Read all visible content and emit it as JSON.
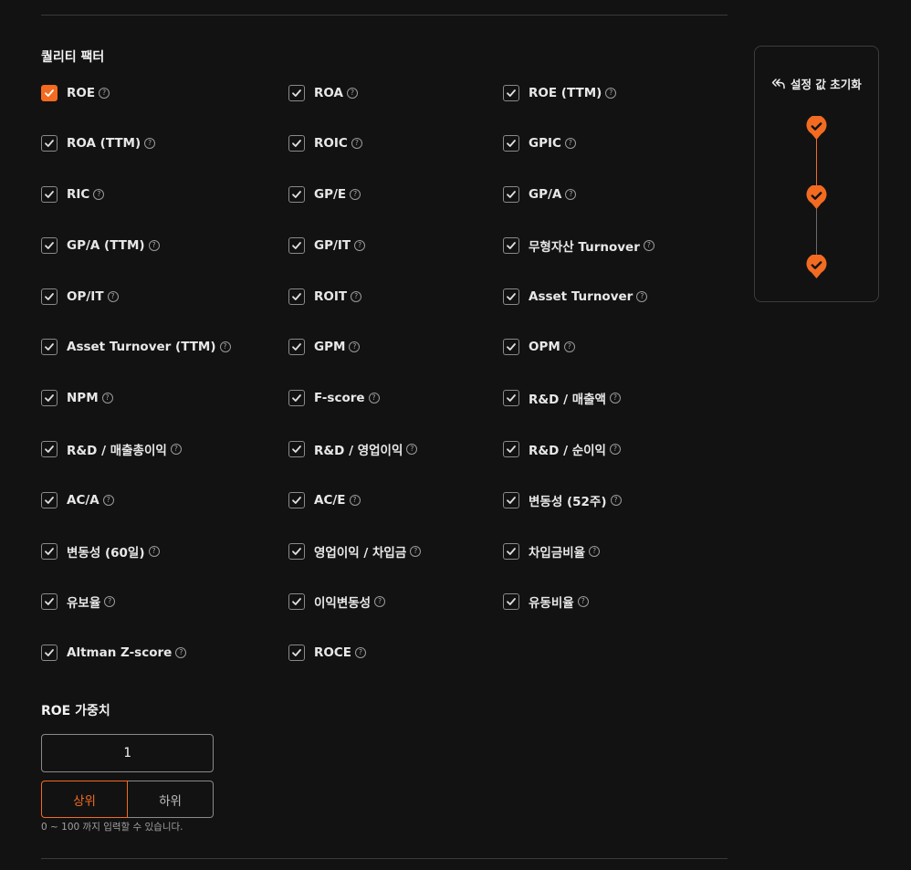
{
  "section_title": "퀄리티 팩터",
  "factors": [
    {
      "label": "ROE",
      "checked": true,
      "active": true
    },
    {
      "label": "ROA",
      "checked": true
    },
    {
      "label": "ROE (TTM)",
      "checked": true
    },
    {
      "label": "ROA (TTM)",
      "checked": true
    },
    {
      "label": "ROIC",
      "checked": true
    },
    {
      "label": "GPIC",
      "checked": true
    },
    {
      "label": "RIC",
      "checked": true
    },
    {
      "label": "GP/E",
      "checked": true
    },
    {
      "label": "GP/A",
      "checked": true
    },
    {
      "label": "GP/A (TTM)",
      "checked": true
    },
    {
      "label": "GP/IT",
      "checked": true
    },
    {
      "label": "무형자산 Turnover",
      "checked": true
    },
    {
      "label": "OP/IT",
      "checked": true
    },
    {
      "label": "ROIT",
      "checked": true
    },
    {
      "label": "Asset Turnover",
      "checked": true
    },
    {
      "label": "Asset Turnover (TTM)",
      "checked": true
    },
    {
      "label": "GPM",
      "checked": true
    },
    {
      "label": "OPM",
      "checked": true
    },
    {
      "label": "NPM",
      "checked": true
    },
    {
      "label": "F-score",
      "checked": true
    },
    {
      "label": "R&D / 매출액",
      "checked": true
    },
    {
      "label": "R&D / 매출총이익",
      "checked": true
    },
    {
      "label": "R&D / 영업이익",
      "checked": true
    },
    {
      "label": "R&D / 순이익",
      "checked": true
    },
    {
      "label": "AC/A",
      "checked": true
    },
    {
      "label": "AC/E",
      "checked": true
    },
    {
      "label": "변동성 (52주)",
      "checked": true
    },
    {
      "label": "변동성 (60일)",
      "checked": true
    },
    {
      "label": "영업이익 / 차입금",
      "checked": true
    },
    {
      "label": "차입금비율",
      "checked": true
    },
    {
      "label": "유보율",
      "checked": true
    },
    {
      "label": "이익변동성",
      "checked": true
    },
    {
      "label": "유동비율",
      "checked": true
    },
    {
      "label": "Altman Z-score",
      "checked": true
    },
    {
      "label": "ROCE",
      "checked": true
    }
  ],
  "help_glyph": "?",
  "weight": {
    "title": "ROE 가중치",
    "value": "1",
    "options": [
      "상위",
      "하위"
    ],
    "selected": "상위",
    "hint": "0 ~ 100 까지 입력할 수 있습니다."
  },
  "side_panel": {
    "reset_label": "설정 값 초기화",
    "reset_icon": "undo-arrow-icon",
    "steps": [
      {
        "state": "complete"
      },
      {
        "state": "complete"
      },
      {
        "state": "complete"
      }
    ]
  },
  "colors": {
    "accent": "#f26b21",
    "background": "#121212",
    "border": "#8a8a8a"
  }
}
